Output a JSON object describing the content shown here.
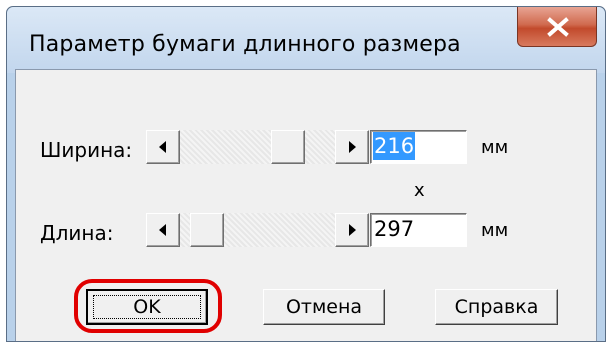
{
  "window": {
    "title": "Параметр бумаги длинного размера",
    "close_label": "X"
  },
  "width_row": {
    "label": "Ширина:",
    "value": "216",
    "unit": "мм",
    "slider_level": 0.75
  },
  "separator": "x",
  "length_row": {
    "label": "Длина:",
    "value": "297",
    "unit": "мм",
    "slider_level": 0.08
  },
  "buttons": {
    "ok": "OK",
    "cancel": "Отмена",
    "help": "Справка"
  },
  "colors": {
    "highlight": "#e00000",
    "selection": "#3399ff",
    "close_button": "#c24a2c"
  }
}
